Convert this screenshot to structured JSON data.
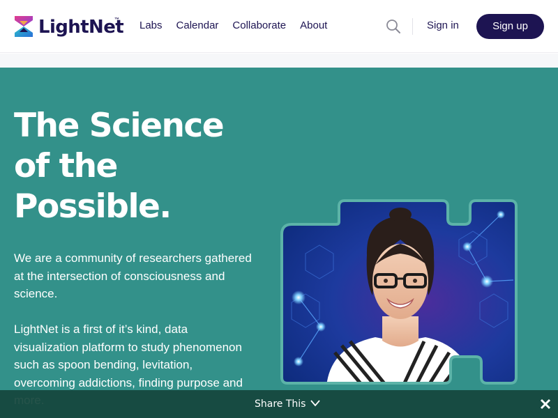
{
  "brand": {
    "name": "LightNet",
    "tm": "™"
  },
  "nav": {
    "items": [
      {
        "label": "Labs"
      },
      {
        "label": "Calendar"
      },
      {
        "label": "Collaborate"
      },
      {
        "label": "About"
      }
    ]
  },
  "header": {
    "search_icon": "search-icon",
    "signin_label": "Sign in",
    "signup_label": "Sign up"
  },
  "hero": {
    "headline": [
      "The Science",
      "of the",
      "Possible."
    ],
    "paragraph1": "We are a community of researchers gathered at the intersection of consciousness and science.",
    "paragraph2": "LightNet is a first of it’s kind, data visualization platform to study phenomenon such as spoon bending, levitation, overcoming addictions, finding purpose and more."
  },
  "share_bar": {
    "label": "Share This",
    "chevron_icon": "chevron-down-icon",
    "close_icon": "close-icon"
  },
  "colors": {
    "brand_navy": "#1d1452",
    "hero_teal": "#33918a",
    "share_bar": "#16463c"
  }
}
